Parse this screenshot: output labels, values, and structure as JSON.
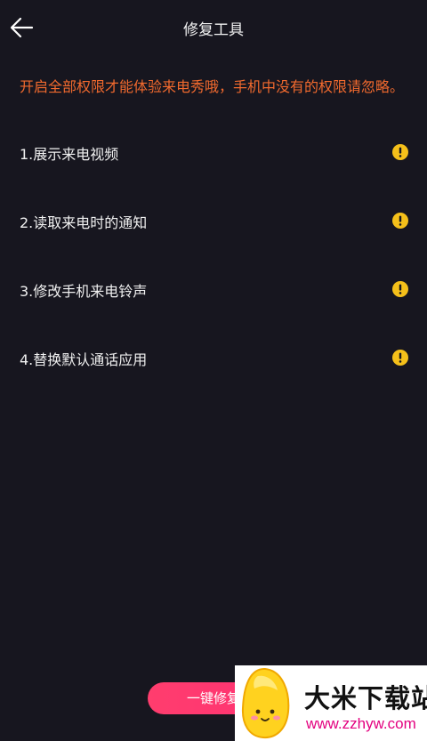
{
  "header": {
    "title": "修复工具"
  },
  "notice": "开启全部权限才能体验来电秀哦，手机中没有的权限请忽略。",
  "permissions": [
    {
      "label": "1.展示来电视频",
      "status_icon": "warning-icon"
    },
    {
      "label": "2.读取来电时的通知",
      "status_icon": "warning-icon"
    },
    {
      "label": "3.修改手机来电铃声",
      "status_icon": "warning-icon"
    },
    {
      "label": "4.替换默认通话应用",
      "status_icon": "warning-icon"
    }
  ],
  "repair_button": {
    "label": "一键修复"
  },
  "watermark": {
    "name": "大米下载站",
    "url": "www.zzhyw.com"
  },
  "colors": {
    "background": "#17161f",
    "notice": "#f26a2e",
    "warning": "#f5c01a",
    "button": "#ff3d6e",
    "watermark_url": "#e3007f"
  }
}
